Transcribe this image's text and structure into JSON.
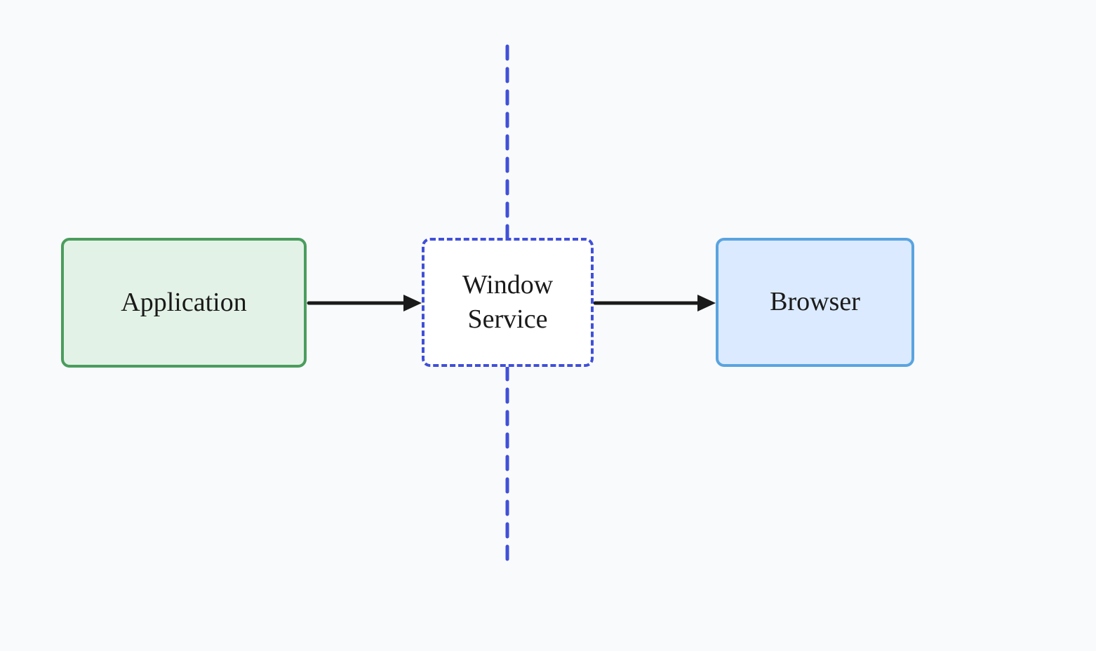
{
  "nodes": {
    "application": {
      "label": "Application"
    },
    "windowService": {
      "label": "Window\nService"
    },
    "browser": {
      "label": "Browser"
    }
  },
  "colors": {
    "background": "#f9fafb",
    "applicationFill": "#e3f2e6",
    "applicationBorder": "#4a9d5e",
    "windowServiceFill": "#ffffff",
    "windowServiceBorder": "#4050d8",
    "browserFill": "#dbeafe",
    "browserBorder": "#5aa4e0",
    "arrow": "#1a1a1a",
    "divider": "#4050d8"
  }
}
